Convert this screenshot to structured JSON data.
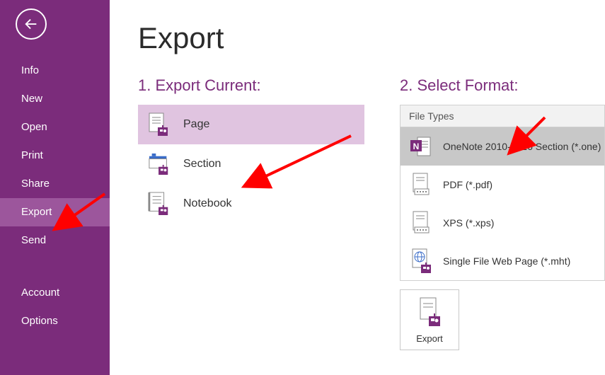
{
  "sidebar": {
    "items": [
      {
        "label": "Info"
      },
      {
        "label": "New"
      },
      {
        "label": "Open"
      },
      {
        "label": "Print"
      },
      {
        "label": "Share"
      },
      {
        "label": "Export"
      },
      {
        "label": "Send"
      },
      {
        "label": "Account"
      },
      {
        "label": "Options"
      }
    ],
    "selected_index": 5
  },
  "title": "Export",
  "step1": {
    "heading": "1. Export Current:",
    "options": [
      {
        "label": "Page"
      },
      {
        "label": "Section"
      },
      {
        "label": "Notebook"
      }
    ],
    "selected_index": 0
  },
  "step2": {
    "heading": "2. Select Format:",
    "group_label": "File Types",
    "formats": [
      {
        "label": "OneNote 2010-2016 Section (*.one)"
      },
      {
        "label": "PDF (*.pdf)"
      },
      {
        "label": "XPS (*.xps)"
      },
      {
        "label": "Single File Web Page (*.mht)"
      }
    ],
    "selected_index": 0
  },
  "export_button_label": "Export",
  "colors": {
    "brand": "#7b2c7b",
    "arrow": "#ff0000"
  }
}
